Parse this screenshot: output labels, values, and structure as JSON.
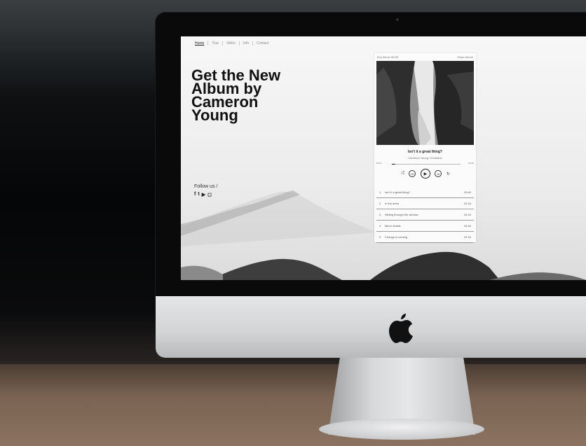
{
  "nav": {
    "items": [
      "Home",
      "Tour",
      "Video",
      "Info",
      "Contact"
    ],
    "active_index": 0
  },
  "hero": {
    "headline": "Get the New Album by Cameron Young"
  },
  "social": {
    "follow_label": "Follow us /",
    "icons": [
      "facebook-icon",
      "twitter-icon",
      "youtube-icon",
      "instagram-icon"
    ],
    "glyphs": [
      "f",
      "t",
      "▶",
      "◻"
    ]
  },
  "player": {
    "buy_label": "Buy Album $9.99",
    "share_label": "Share Album",
    "current_track": "Isn't it a great thing?",
    "artist_album": "Cameron Young / Evolution",
    "time_elapsed": "00:12",
    "time_total": "03:40",
    "progress_fraction": 0.05,
    "controls": {
      "shuffle": "⤮",
      "prev": "⏮",
      "play": "▶",
      "next": "⏭",
      "repeat": "↻"
    },
    "tracks": [
      {
        "num": "1",
        "title": "Isn't it a great thing?",
        "duration": "03:40"
      },
      {
        "num": "2",
        "title": "In the arms",
        "duration": "02:16"
      },
      {
        "num": "3",
        "title": "Sliding through the window",
        "duration": "02:43"
      },
      {
        "num": "4",
        "title": "Minor details",
        "duration": "03:40"
      },
      {
        "num": "5",
        "title": "Change is coming",
        "duration": "02:16"
      }
    ]
  },
  "colors": {
    "screen_bg": "#f2f2f2",
    "text_dark": "#111111",
    "aluminum": "#d2d3d5"
  }
}
